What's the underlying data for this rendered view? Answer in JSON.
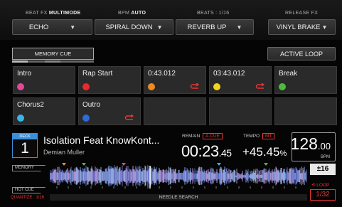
{
  "fx": {
    "beat_fx_label": "BEAT FX",
    "beat_fx_mode": "MULTIMODE",
    "bpm_label": "BPM",
    "bpm_mode": "AUTO",
    "beats_label": "BEATS : 1/16",
    "release_fx_label": "RELEASE FX",
    "buttons": [
      {
        "label": "ECHO",
        "arrow": "▼"
      },
      {
        "label": "SPIRAL DOWN",
        "arrow": "▼"
      },
      {
        "label": "REVERB UP",
        "arrow": "▼"
      },
      {
        "label": "VINYL BRAKE",
        "arrow": "▼"
      }
    ]
  },
  "memory_cue_label": "MEMORY CUE",
  "active_loop_label": "ACTIVE LOOP",
  "hot_cues": [
    {
      "label": "Intro",
      "color": "#e0499a",
      "loop": false
    },
    {
      "label": "Rap Start",
      "color": "#e82a2a",
      "loop": false
    },
    {
      "label": "0:43.012",
      "color": "#f08a1c",
      "loop": true
    },
    {
      "label": "03:43.012",
      "color": "#f5d21e",
      "loop": true
    },
    {
      "label": "Break",
      "color": "#4cbb3a",
      "loop": false
    },
    {
      "label": "Chorus2",
      "color": "#38b6e8",
      "loop": false
    },
    {
      "label": "Outro",
      "color": "#2f6ad8",
      "loop": true
    },
    {
      "label": "",
      "color": "",
      "loop": false
    },
    {
      "label": "",
      "color": "",
      "loop": false
    },
    {
      "label": "",
      "color": "",
      "loop": false
    }
  ],
  "deck": {
    "deck_label": "DECK",
    "number": "1",
    "title": "Isolation Feat KnowKont...",
    "artist": "Demian Muller",
    "remain_label": "REMAIN",
    "acue_label": "A.CUE",
    "time_main": "00:23",
    "time_frac": ".45",
    "tempo_label": "TEMPO",
    "mt_label": "MT",
    "tempo_main": "+45.45",
    "tempo_unit": "%",
    "bpm_main": "128",
    "bpm_frac": ".00",
    "bpm_unit": "BPM",
    "memory_tag": "MEMORY",
    "hot_cue_tag": "HOT CUE",
    "quantize": "QUANTIZE : 1/16",
    "needle_search": "NEEDLE SEARCH",
    "tempo_range": "±16",
    "loop_label": "LOOP",
    "loop_value": "1/32",
    "playhead_fraction": 0.39
  },
  "colors": {
    "accent_blue": "#3a8fd8",
    "alert_red": "#e33333",
    "pad_bg": "#2a2a2a"
  }
}
